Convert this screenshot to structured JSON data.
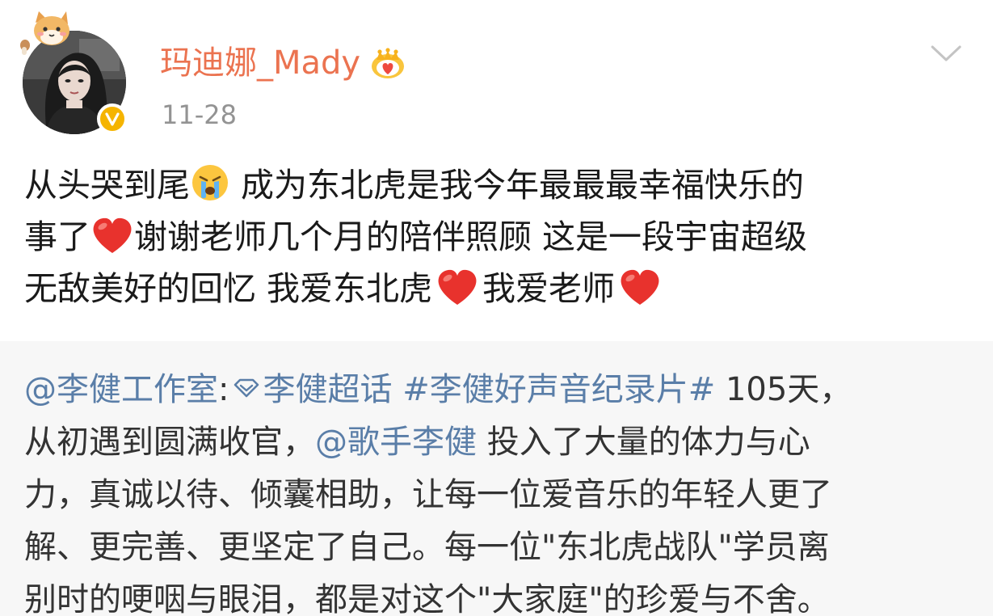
{
  "header": {
    "username": "玛迪娜_Mady",
    "date": "11-28",
    "icons": {
      "avatar": "avatar",
      "pendant": "cat-pendant-icon",
      "verified": "verified-icon",
      "crown": "crown-icon",
      "menu": "chevron-down-icon"
    }
  },
  "post": {
    "line1_a": "从头哭到尾",
    "line1_b": " 成为东北虎是我今年最最最幸福快乐的",
    "line2_a": "事了",
    "line2_b": "谢谢老师几个月的陪伴照顾 这是一段宇宙超级",
    "line3_a": "无敌美好的回忆 我爱东北虎",
    "line3_b": "我爱老师",
    "emoji_names": [
      "crying-face-emoji",
      "red-heart-emoji"
    ]
  },
  "retweet": {
    "mention_studio": "@李健工作室",
    "colon": ":",
    "super_topic": "李健超话",
    "hashtag": "#李健好声音纪录片#",
    "text_1": " 105天，",
    "text_2": "从初遇到圆满收官，",
    "mention_singer": "@歌手李健",
    "text_3": " 投入了大量的体力与心",
    "text_4": "力，真诚以待、倾囊相助，让每一位爱音乐的年轻人更了",
    "text_5": "解、更完善、更坚定了自己。每一位\"东北虎战队\"学员离",
    "text_6": "别时的哽咽与眼泪，都是对这个\"大家庭\"的珍爱与不舍。"
  },
  "colors": {
    "username": "#eb7350",
    "link": "#5a7ea8",
    "date": "#939393",
    "retweet_bg": "#f7f7f7",
    "verified": "#f5b400",
    "heart": "#e8322d"
  }
}
